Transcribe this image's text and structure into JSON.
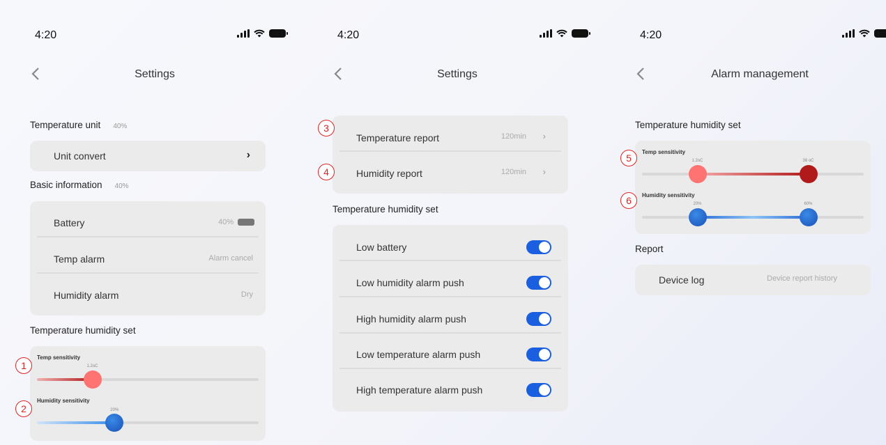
{
  "screens": [
    {
      "time": "4:20",
      "title": "Settings",
      "temperature_unit": {
        "label": "Temperature unit",
        "value": "40%"
      },
      "unit_convert": {
        "label": "Unit convert"
      },
      "basic_info": {
        "label": "Basic information",
        "value": "40%"
      },
      "basic_rows": [
        {
          "label": "Battery",
          "value": "40%"
        },
        {
          "label": "Temp alarm",
          "value": "Alarm cancel"
        },
        {
          "label": "Humidity alarm",
          "value": "Dry"
        }
      ],
      "th_set_label": "Temperature humidity set",
      "sliders": [
        {
          "marker": "1",
          "title": "Temp sensitivity",
          "value_label": "1.2oC",
          "level": 0.25
        },
        {
          "marker": "2",
          "title": "Humidity sensitivity",
          "value_label": "20%",
          "level": 0.35
        }
      ]
    },
    {
      "time": "4:20",
      "title": "Settings",
      "reports": [
        {
          "marker": "3",
          "label": "Temperature report",
          "value": "120min"
        },
        {
          "marker": "4",
          "label": "Humidity report",
          "value": "120min"
        }
      ],
      "th_set_label": "Temperature humidity set",
      "toggles": [
        {
          "label": "Low battery",
          "on": true
        },
        {
          "label": "Low humidity alarm push",
          "on": true
        },
        {
          "label": "High humidity alarm push",
          "on": true
        },
        {
          "label": "Low temperature alarm push",
          "on": true
        },
        {
          "label": "High temperature alarm push",
          "on": true
        }
      ]
    },
    {
      "time": "4:20",
      "title": "Alarm management",
      "th_set_label": "Temperature humidity set",
      "range_sliders": [
        {
          "marker": "5",
          "title": "Temp sensitivity",
          "low_label": "1.2oC",
          "high_label": "38 oC",
          "low": 0.25,
          "high": 0.75
        },
        {
          "marker": "6",
          "title": "Humidity sensitivity",
          "low_label": "20%",
          "high_label": "60%",
          "low": 0.25,
          "high": 0.75
        }
      ],
      "report_label": "Report",
      "device_log": {
        "label": "Device log",
        "value": "Device report history"
      }
    }
  ],
  "colors": {
    "toggle_on": "#1a5fe0",
    "temp_knob": "#ff6b6b",
    "temp_knob_dark": "#b01a1a",
    "humidity_knob": "#1f5fc8",
    "marker": "#dd2222"
  }
}
